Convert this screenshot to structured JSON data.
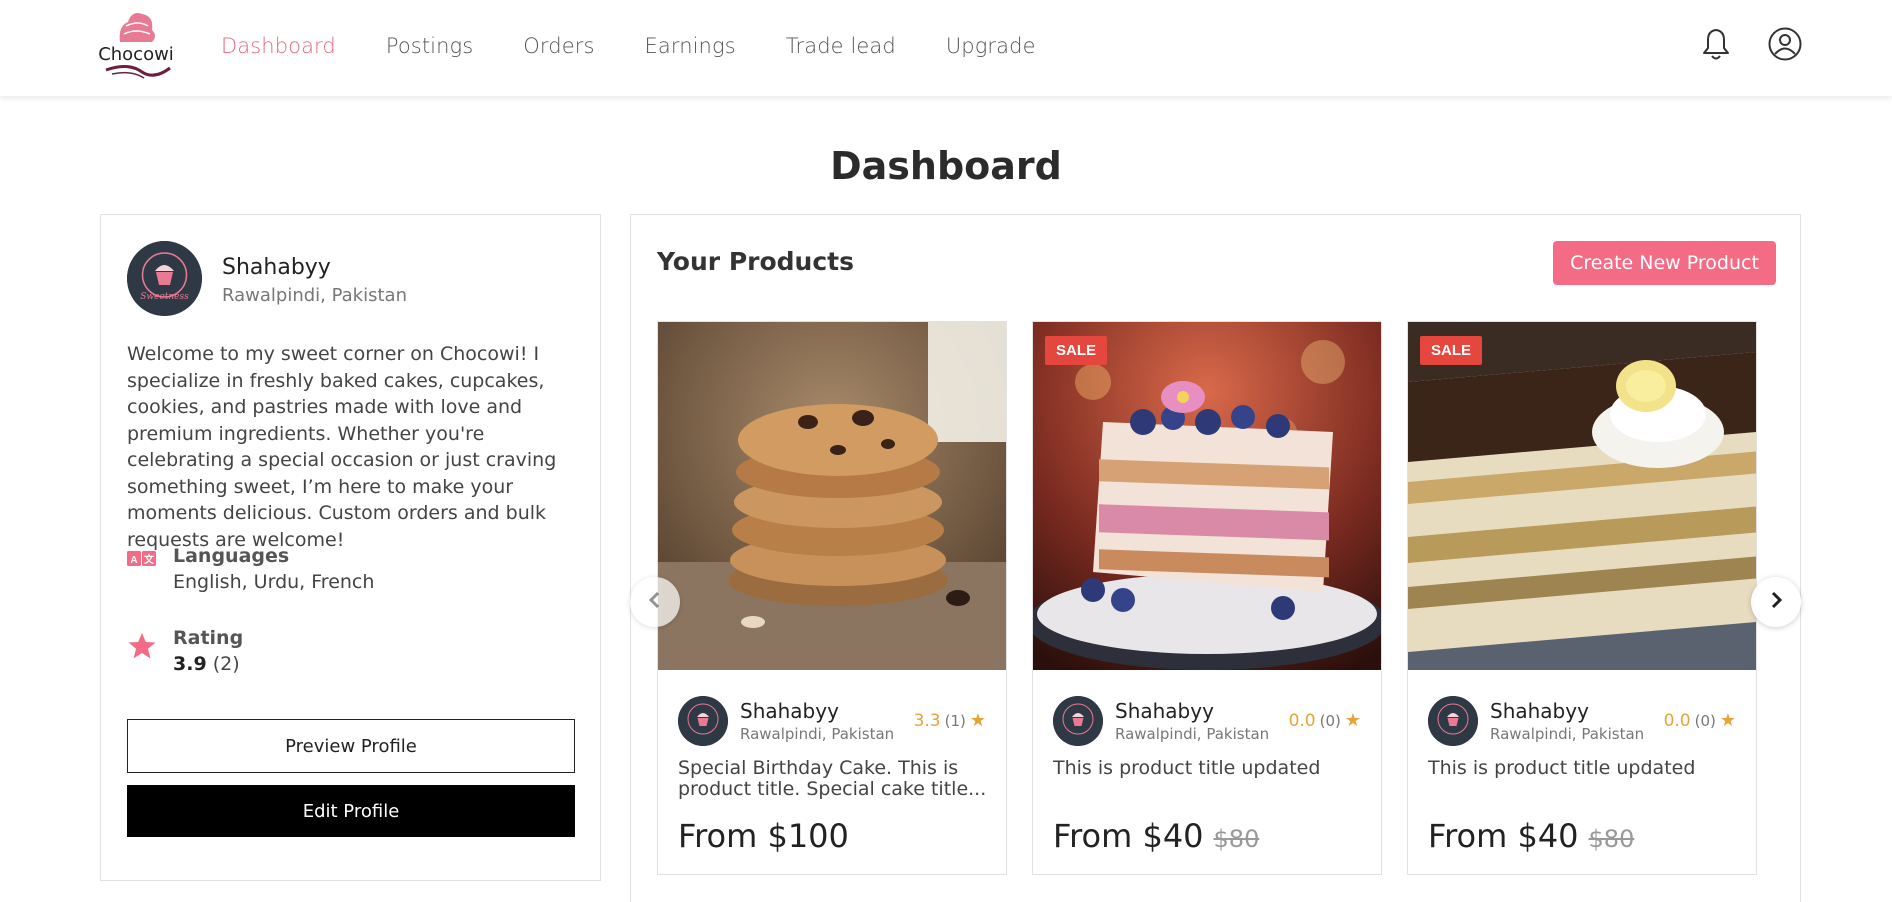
{
  "brand": {
    "name": "Chocowi",
    "accent": "#e66a82",
    "button_pink": "#f46b86"
  },
  "nav": {
    "links": [
      {
        "label": "Dashboard",
        "active": true
      },
      {
        "label": "Postings",
        "active": false
      },
      {
        "label": "Orders",
        "active": false
      },
      {
        "label": "Earnings",
        "active": false
      },
      {
        "label": "Trade lead",
        "active": false
      },
      {
        "label": "Upgrade",
        "active": false
      }
    ],
    "icons": [
      "bell-icon",
      "user-icon"
    ]
  },
  "page": {
    "title": "Dashboard"
  },
  "profile": {
    "name": "Shahabyy",
    "location": "Rawalpindi, Pakistan",
    "bio": "Welcome to my sweet corner on Chocowi! I specialize in freshly baked cakes, cupcakes, cookies, and pastries made with love and premium ingredients. Whether you're celebrating a special occasion or just craving something sweet, I’m here to make your moments delicious. Custom orders and bulk requests are welcome!",
    "languages_label": "Languages",
    "languages_value": "English, Urdu, French",
    "rating_label": "Rating",
    "rating_value": "3.9",
    "rating_count": "(2)",
    "preview_button": "Preview Profile",
    "edit_button": "Edit Profile"
  },
  "products": {
    "title": "Your Products",
    "create_button": "Create New Product",
    "items": [
      {
        "image": "cookies-stack",
        "sale": false,
        "seller_name": "Shahabyy",
        "seller_location": "Rawalpindi, Pakistan",
        "rating": "3.3",
        "rating_count": "(1)",
        "title": "Special Birthday Cake. This is product title. Special cake title...",
        "price": "From $100",
        "old_price": ""
      },
      {
        "image": "berry-layer-cake",
        "sale": true,
        "sale_label": "SALE",
        "seller_name": "Shahabyy",
        "seller_location": "Rawalpindi, Pakistan",
        "rating": "0.0",
        "rating_count": "(0)",
        "title": "This is product title updated",
        "price": "From $40",
        "old_price": "$80"
      },
      {
        "image": "tiramisu-slice",
        "sale": true,
        "sale_label": "SALE",
        "seller_name": "Shahabyy",
        "seller_location": "Rawalpindi, Pakistan",
        "rating": "0.0",
        "rating_count": "(0)",
        "title": "This is product title updated",
        "price": "From $40",
        "old_price": "$80"
      }
    ]
  }
}
